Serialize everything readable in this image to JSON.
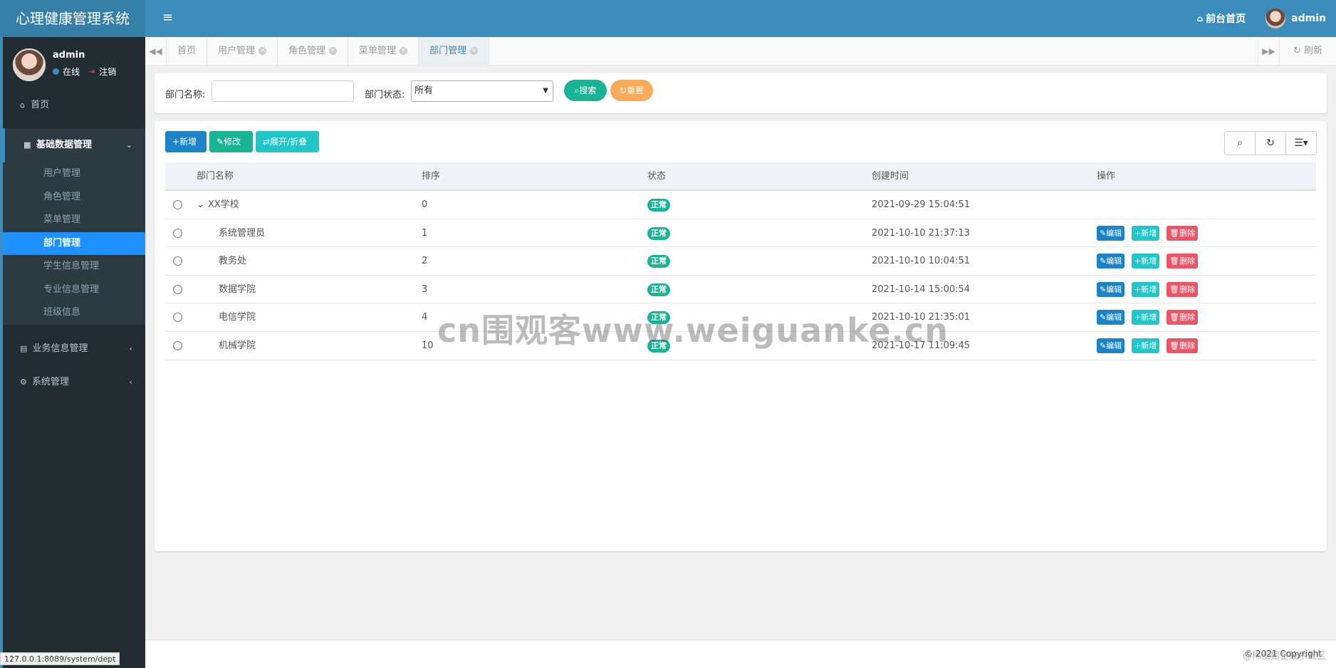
{
  "app": {
    "title": "心理健康管理系统"
  },
  "topbar": {
    "home_link": "前台首页",
    "user": "admin"
  },
  "user_panel": {
    "name": "admin",
    "online": "在线",
    "logout": "注销"
  },
  "sidebar": {
    "home": "首页",
    "group_basic": "基础数据管理",
    "sub_items": [
      "用户管理",
      "角色管理",
      "菜单管理",
      "部门管理",
      "学生信息管理",
      "专业信息管理",
      "班级信息"
    ],
    "group_business": "业务信息管理",
    "group_system": "系统管理"
  },
  "tabs": [
    "首页",
    "用户管理",
    "角色管理",
    "菜单管理",
    "部门管理"
  ],
  "tabs_refresh": "刷新",
  "search": {
    "dept_name_label": "部门名称:",
    "dept_name_value": "",
    "status_label": "部门状态:",
    "status_value": "所有",
    "search_btn": "搜索",
    "reset_btn": "重置"
  },
  "toolbar": {
    "add": "新增",
    "edit": "修改",
    "toggle": "展开/折叠"
  },
  "table": {
    "headers": [
      "部门名称",
      "排序",
      "状态",
      "创建时间",
      "操作"
    ],
    "rows": [
      {
        "name": "XX学校",
        "order": "0",
        "status": "正常",
        "created": "2021-09-29 15:04:51",
        "actions": false
      },
      {
        "name": "系统管理员",
        "order": "1",
        "status": "正常",
        "created": "2021-10-10 21:37:13",
        "actions": true
      },
      {
        "name": "教务处",
        "order": "2",
        "status": "正常",
        "created": "2021-10-10 10:04:51",
        "actions": true
      },
      {
        "name": "数据学院",
        "order": "3",
        "status": "正常",
        "created": "2021-10-14 15:00:54",
        "actions": true
      },
      {
        "name": "电信学院",
        "order": "4",
        "status": "正常",
        "created": "2021-10-10 21:35:01",
        "actions": true
      },
      {
        "name": "机械学院",
        "order": "10",
        "status": "正常",
        "created": "2021-10-17 11:09:45",
        "actions": true
      }
    ],
    "action_labels": {
      "edit": "编辑",
      "add": "新增",
      "delete": "删除"
    }
  },
  "watermark": "cn围观客www.weiguanke.cn",
  "footer": {
    "copyright": "© 2021 Copyright"
  },
  "status_url": "127.0.0.1:8089/system/dept",
  "corner_watermark": "@稀土掘金技术社区",
  "colors": {
    "topbar": "#3c8dbc",
    "sidebar": "#222d32",
    "active_menu": "#1e90ff",
    "primary": "#1c84c6",
    "success": "#1ab394",
    "info": "#23c6c8",
    "warning": "#f8ac59",
    "danger": "#ed5565"
  }
}
